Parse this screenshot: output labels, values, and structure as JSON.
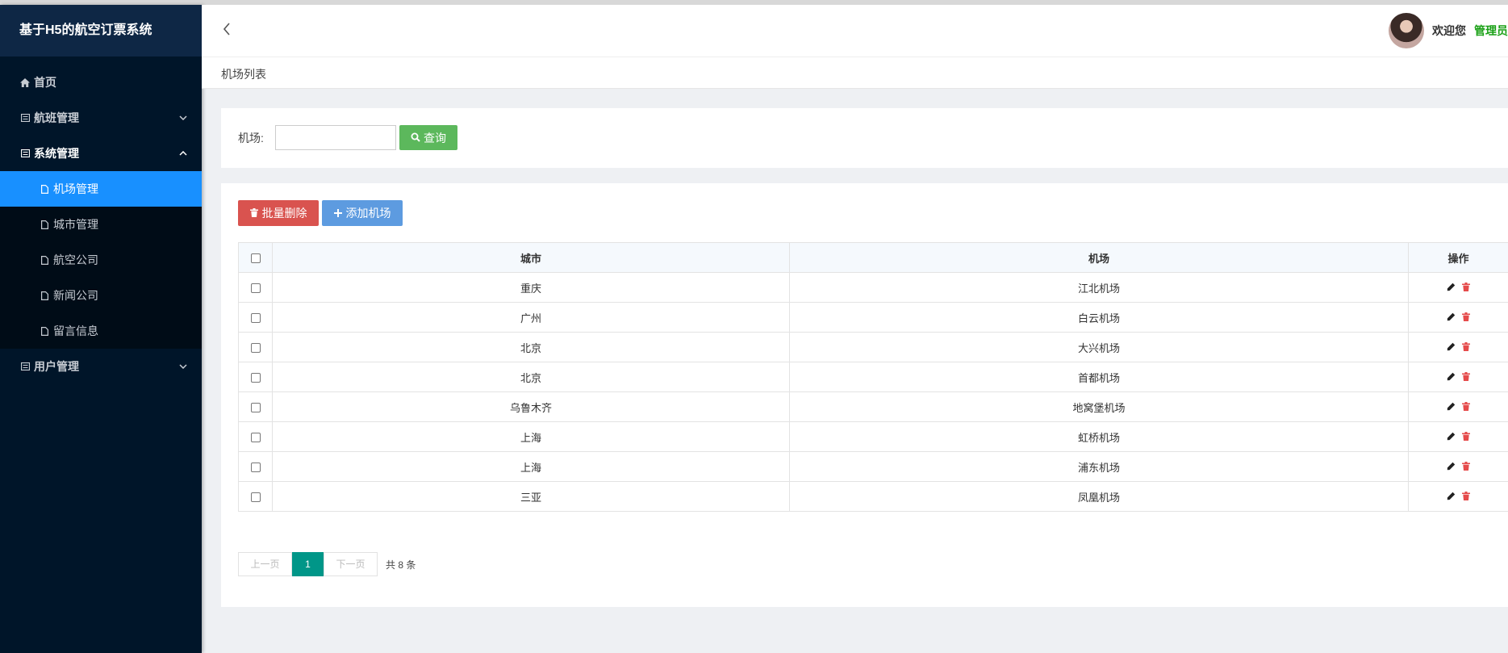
{
  "app": {
    "title": "基于H5的航空订票系统"
  },
  "sidebar": {
    "items": [
      {
        "label": "首页",
        "icon": "home-icon"
      },
      {
        "label": "航班管理",
        "icon": "list-icon",
        "expanded": false
      },
      {
        "label": "系统管理",
        "icon": "list-icon",
        "expanded": true,
        "children": [
          {
            "label": "机场管理",
            "icon": "file-icon",
            "active": true
          },
          {
            "label": "城市管理",
            "icon": "file-icon"
          },
          {
            "label": "航空公司",
            "icon": "file-icon"
          },
          {
            "label": "新闻公司",
            "icon": "file-icon"
          },
          {
            "label": "留言信息",
            "icon": "file-icon"
          }
        ]
      },
      {
        "label": "用户管理",
        "icon": "list-icon",
        "expanded": false
      }
    ]
  },
  "header": {
    "welcome": "欢迎您",
    "username": "管理员"
  },
  "breadcrumb": {
    "current": "机场列表"
  },
  "search": {
    "label": "机场:",
    "value": "",
    "button": "查询"
  },
  "toolbar": {
    "batch_delete": "批量删除",
    "add": "添加机场"
  },
  "table": {
    "headers": {
      "city": "城市",
      "airport": "机场",
      "actions": "操作"
    },
    "rows": [
      {
        "city": "重庆",
        "airport": "江北机场"
      },
      {
        "city": "广州",
        "airport": "白云机场"
      },
      {
        "city": "北京",
        "airport": "大兴机场"
      },
      {
        "city": "北京",
        "airport": "首都机场"
      },
      {
        "city": "乌鲁木齐",
        "airport": "地窝堡机场"
      },
      {
        "city": "上海",
        "airport": "虹桥机场"
      },
      {
        "city": "上海",
        "airport": "浦东机场"
      },
      {
        "city": "三亚",
        "airport": "凤凰机场"
      }
    ]
  },
  "pagination": {
    "prev": "上一页",
    "current": "1",
    "next": "下一页",
    "total": "共 8 条"
  },
  "colors": {
    "sidebar_bg": "#001529",
    "active": "#1890ff",
    "search_btn": "#5cb85c",
    "delete_btn": "#d9534f",
    "add_btn": "#5d9be0",
    "page_current": "#009688",
    "username": "#19a015"
  }
}
